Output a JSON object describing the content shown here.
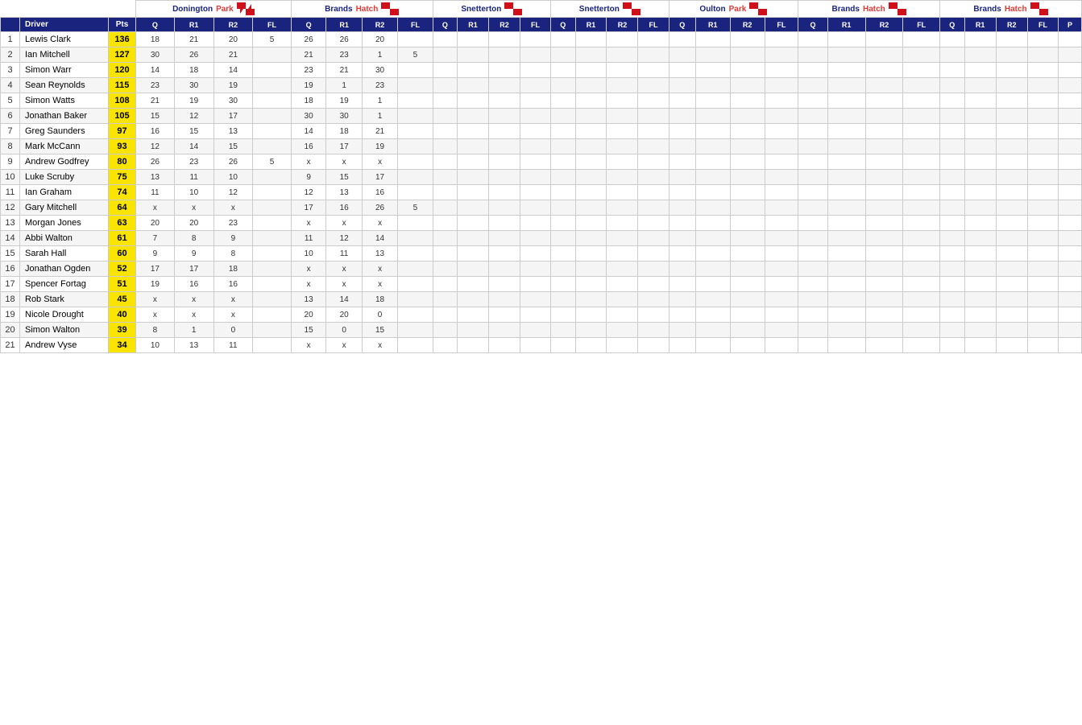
{
  "venues": [
    {
      "name": "DoningtonPark",
      "name1": "Donington",
      "name2": "Park",
      "cols": [
        "Q",
        "R1",
        "R2",
        "FL"
      ]
    },
    {
      "name": "BrandsHatch",
      "name1": "Brands",
      "name2": "Hatch",
      "cols": [
        "Q",
        "R1",
        "R2",
        "FL"
      ]
    },
    {
      "name": "Snetterton",
      "name1": "Snetterton",
      "name2": "",
      "cols": [
        "Q",
        "R1",
        "R2",
        "FL"
      ]
    },
    {
      "name": "Snetterton2",
      "name1": "Snetterton",
      "name2": "",
      "cols": [
        "Q",
        "R1",
        "R2",
        "FL"
      ]
    },
    {
      "name": "OultonPark",
      "name1": "Oulton",
      "name2": "Park",
      "cols": [
        "Q",
        "R1",
        "R2",
        "FL"
      ]
    },
    {
      "name": "BrandsHatch2",
      "name1": "Brands",
      "name2": "Hatch",
      "cols": [
        "Q",
        "R1",
        "R2",
        "FL"
      ]
    },
    {
      "name": "BrandsHatch3",
      "name1": "Brands",
      "name2": "Hatch",
      "cols": [
        "Q",
        "R1",
        "R2",
        "FL",
        "P"
      ]
    }
  ],
  "drivers": [
    {
      "pos": 1,
      "name": "Lewis Clark",
      "pts": 136,
      "d1": [
        "18",
        "21",
        "20",
        "5"
      ],
      "d2": [
        "26",
        "26",
        "20",
        ""
      ],
      "d3": [
        "",
        "",
        "",
        ""
      ],
      "d4": [
        "",
        "",
        "",
        ""
      ],
      "d5": [
        "",
        "",
        "",
        ""
      ],
      "d6": [
        "",
        "",
        "",
        ""
      ],
      "d7": [
        "",
        "",
        "",
        "",
        ""
      ]
    },
    {
      "pos": 2,
      "name": "Ian Mitchell",
      "pts": 127,
      "d1": [
        "30",
        "26",
        "21",
        ""
      ],
      "d2": [
        "21",
        "23",
        "1",
        "5"
      ],
      "d3": [
        "",
        "",
        "",
        ""
      ],
      "d4": [
        "",
        "",
        "",
        ""
      ],
      "d5": [
        "",
        "",
        "",
        ""
      ],
      "d6": [
        "",
        "",
        "",
        ""
      ],
      "d7": [
        "",
        "",
        "",
        "",
        ""
      ]
    },
    {
      "pos": 3,
      "name": "Simon Warr",
      "pts": 120,
      "d1": [
        "14",
        "18",
        "14",
        ""
      ],
      "d2": [
        "23",
        "21",
        "30",
        ""
      ],
      "d3": [
        "",
        "",
        "",
        ""
      ],
      "d4": [
        "",
        "",
        "",
        ""
      ],
      "d5": [
        "",
        "",
        "",
        ""
      ],
      "d6": [
        "",
        "",
        "",
        ""
      ],
      "d7": [
        "",
        "",
        "",
        "",
        ""
      ]
    },
    {
      "pos": 4,
      "name": "Sean Reynolds",
      "pts": 115,
      "d1": [
        "23",
        "30",
        "19",
        ""
      ],
      "d2": [
        "19",
        "1",
        "23",
        ""
      ],
      "d3": [
        "",
        "",
        "",
        ""
      ],
      "d4": [
        "",
        "",
        "",
        ""
      ],
      "d5": [
        "",
        "",
        "",
        ""
      ],
      "d6": [
        "",
        "",
        "",
        ""
      ],
      "d7": [
        "",
        "",
        "",
        "",
        ""
      ]
    },
    {
      "pos": 5,
      "name": "Simon Watts",
      "pts": 108,
      "d1": [
        "21",
        "19",
        "30",
        ""
      ],
      "d2": [
        "18",
        "19",
        "1",
        ""
      ],
      "d3": [
        "",
        "",
        "",
        ""
      ],
      "d4": [
        "",
        "",
        "",
        ""
      ],
      "d5": [
        "",
        "",
        "",
        ""
      ],
      "d6": [
        "",
        "",
        "",
        ""
      ],
      "d7": [
        "",
        "",
        "",
        "",
        ""
      ]
    },
    {
      "pos": 6,
      "name": "Jonathan Baker",
      "pts": 105,
      "d1": [
        "15",
        "12",
        "17",
        ""
      ],
      "d2": [
        "30",
        "30",
        "1",
        ""
      ],
      "d3": [
        "",
        "",
        "",
        ""
      ],
      "d4": [
        "",
        "",
        "",
        ""
      ],
      "d5": [
        "",
        "",
        "",
        ""
      ],
      "d6": [
        "",
        "",
        "",
        ""
      ],
      "d7": [
        "",
        "",
        "",
        "",
        ""
      ]
    },
    {
      "pos": 7,
      "name": "Greg Saunders",
      "pts": 97,
      "d1": [
        "16",
        "15",
        "13",
        ""
      ],
      "d2": [
        "14",
        "18",
        "21",
        ""
      ],
      "d3": [
        "",
        "",
        "",
        ""
      ],
      "d4": [
        "",
        "",
        "",
        ""
      ],
      "d5": [
        "",
        "",
        "",
        ""
      ],
      "d6": [
        "",
        "",
        "",
        ""
      ],
      "d7": [
        "",
        "",
        "",
        "",
        ""
      ]
    },
    {
      "pos": 8,
      "name": "Mark McCann",
      "pts": 93,
      "d1": [
        "12",
        "14",
        "15",
        ""
      ],
      "d2": [
        "16",
        "17",
        "19",
        ""
      ],
      "d3": [
        "",
        "",
        "",
        ""
      ],
      "d4": [
        "",
        "",
        "",
        ""
      ],
      "d5": [
        "",
        "",
        "",
        ""
      ],
      "d6": [
        "",
        "",
        "",
        ""
      ],
      "d7": [
        "",
        "",
        "",
        "",
        ""
      ]
    },
    {
      "pos": 9,
      "name": "Andrew Godfrey",
      "pts": 80,
      "d1": [
        "26",
        "23",
        "26",
        "5"
      ],
      "d2": [
        "x",
        "x",
        "x",
        ""
      ],
      "d3": [
        "",
        "",
        "",
        ""
      ],
      "d4": [
        "",
        "",
        "",
        ""
      ],
      "d5": [
        "",
        "",
        "",
        ""
      ],
      "d6": [
        "",
        "",
        "",
        ""
      ],
      "d7": [
        "",
        "",
        "",
        "",
        ""
      ]
    },
    {
      "pos": 10,
      "name": "Luke Scruby",
      "pts": 75,
      "d1": [
        "13",
        "11",
        "10",
        ""
      ],
      "d2": [
        "9",
        "15",
        "17",
        ""
      ],
      "d3": [
        "",
        "",
        "",
        ""
      ],
      "d4": [
        "",
        "",
        "",
        ""
      ],
      "d5": [
        "",
        "",
        "",
        ""
      ],
      "d6": [
        "",
        "",
        "",
        ""
      ],
      "d7": [
        "",
        "",
        "",
        "",
        ""
      ]
    },
    {
      "pos": 11,
      "name": "Ian Graham",
      "pts": 74,
      "d1": [
        "11",
        "10",
        "12",
        ""
      ],
      "d2": [
        "12",
        "13",
        "16",
        ""
      ],
      "d3": [
        "",
        "",
        "",
        ""
      ],
      "d4": [
        "",
        "",
        "",
        ""
      ],
      "d5": [
        "",
        "",
        "",
        ""
      ],
      "d6": [
        "",
        "",
        "",
        ""
      ],
      "d7": [
        "",
        "",
        "",
        "",
        ""
      ]
    },
    {
      "pos": 12,
      "name": "Gary Mitchell",
      "pts": 64,
      "d1": [
        "x",
        "x",
        "x",
        ""
      ],
      "d2": [
        "17",
        "16",
        "26",
        "5"
      ],
      "d3": [
        "",
        "",
        "",
        ""
      ],
      "d4": [
        "",
        "",
        "",
        ""
      ],
      "d5": [
        "",
        "",
        "",
        ""
      ],
      "d6": [
        "",
        "",
        "",
        ""
      ],
      "d7": [
        "",
        "",
        "",
        "",
        ""
      ]
    },
    {
      "pos": 13,
      "name": "Morgan Jones",
      "pts": 63,
      "d1": [
        "20",
        "20",
        "23",
        ""
      ],
      "d2": [
        "x",
        "x",
        "x",
        ""
      ],
      "d3": [
        "",
        "",
        "",
        ""
      ],
      "d4": [
        "",
        "",
        "",
        ""
      ],
      "d5": [
        "",
        "",
        "",
        ""
      ],
      "d6": [
        "",
        "",
        "",
        ""
      ],
      "d7": [
        "",
        "",
        "",
        "",
        ""
      ]
    },
    {
      "pos": 14,
      "name": "Abbi Walton",
      "pts": 61,
      "d1": [
        "7",
        "8",
        "9",
        ""
      ],
      "d2": [
        "11",
        "12",
        "14",
        ""
      ],
      "d3": [
        "",
        "",
        "",
        ""
      ],
      "d4": [
        "",
        "",
        "",
        ""
      ],
      "d5": [
        "",
        "",
        "",
        ""
      ],
      "d6": [
        "",
        "",
        "",
        ""
      ],
      "d7": [
        "",
        "",
        "",
        "",
        ""
      ]
    },
    {
      "pos": 15,
      "name": "Sarah Hall",
      "pts": 60,
      "d1": [
        "9",
        "9",
        "8",
        ""
      ],
      "d2": [
        "10",
        "11",
        "13",
        ""
      ],
      "d3": [
        "",
        "",
        "",
        ""
      ],
      "d4": [
        "",
        "",
        "",
        ""
      ],
      "d5": [
        "",
        "",
        "",
        ""
      ],
      "d6": [
        "",
        "",
        "",
        ""
      ],
      "d7": [
        "",
        "",
        "",
        "",
        ""
      ]
    },
    {
      "pos": 16,
      "name": "Jonathan Ogden",
      "pts": 52,
      "d1": [
        "17",
        "17",
        "18",
        ""
      ],
      "d2": [
        "x",
        "x",
        "x",
        ""
      ],
      "d3": [
        "",
        "",
        "",
        ""
      ],
      "d4": [
        "",
        "",
        "",
        ""
      ],
      "d5": [
        "",
        "",
        "",
        ""
      ],
      "d6": [
        "",
        "",
        "",
        ""
      ],
      "d7": [
        "",
        "",
        "",
        "",
        ""
      ]
    },
    {
      "pos": 17,
      "name": "Spencer Fortag",
      "pts": 51,
      "d1": [
        "19",
        "16",
        "16",
        ""
      ],
      "d2": [
        "x",
        "x",
        "x",
        ""
      ],
      "d3": [
        "",
        "",
        "",
        ""
      ],
      "d4": [
        "",
        "",
        "",
        ""
      ],
      "d5": [
        "",
        "",
        "",
        ""
      ],
      "d6": [
        "",
        "",
        "",
        ""
      ],
      "d7": [
        "",
        "",
        "",
        "",
        ""
      ]
    },
    {
      "pos": 18,
      "name": "Rob Stark",
      "pts": 45,
      "d1": [
        "x",
        "x",
        "x",
        ""
      ],
      "d2": [
        "13",
        "14",
        "18",
        ""
      ],
      "d3": [
        "",
        "",
        "",
        ""
      ],
      "d4": [
        "",
        "",
        "",
        ""
      ],
      "d5": [
        "",
        "",
        "",
        ""
      ],
      "d6": [
        "",
        "",
        "",
        ""
      ],
      "d7": [
        "",
        "",
        "",
        "",
        ""
      ]
    },
    {
      "pos": 19,
      "name": "Nicole Drought",
      "pts": 40,
      "d1": [
        "x",
        "x",
        "x",
        ""
      ],
      "d2": [
        "20",
        "20",
        "0",
        ""
      ],
      "d3": [
        "",
        "",
        "",
        ""
      ],
      "d4": [
        "",
        "",
        "",
        ""
      ],
      "d5": [
        "",
        "",
        "",
        ""
      ],
      "d6": [
        "",
        "",
        "",
        ""
      ],
      "d7": [
        "",
        "",
        "",
        "",
        ""
      ]
    },
    {
      "pos": 20,
      "name": "Simon Walton",
      "pts": 39,
      "d1": [
        "8",
        "1",
        "0",
        ""
      ],
      "d2": [
        "15",
        "0",
        "15",
        ""
      ],
      "d3": [
        "",
        "",
        "",
        ""
      ],
      "d4": [
        "",
        "",
        "",
        ""
      ],
      "d5": [
        "",
        "",
        "",
        ""
      ],
      "d6": [
        "",
        "",
        "",
        ""
      ],
      "d7": [
        "",
        "",
        "",
        "",
        ""
      ]
    },
    {
      "pos": 21,
      "name": "Andrew Vyse",
      "pts": 34,
      "d1": [
        "10",
        "13",
        "11",
        ""
      ],
      "d2": [
        "x",
        "x",
        "x",
        ""
      ],
      "d3": [
        "",
        "",
        "",
        ""
      ],
      "d4": [
        "",
        "",
        "",
        ""
      ],
      "d5": [
        "",
        "",
        "",
        ""
      ],
      "d6": [
        "",
        "",
        "",
        ""
      ],
      "d7": [
        "",
        "",
        "",
        "",
        ""
      ]
    }
  ]
}
